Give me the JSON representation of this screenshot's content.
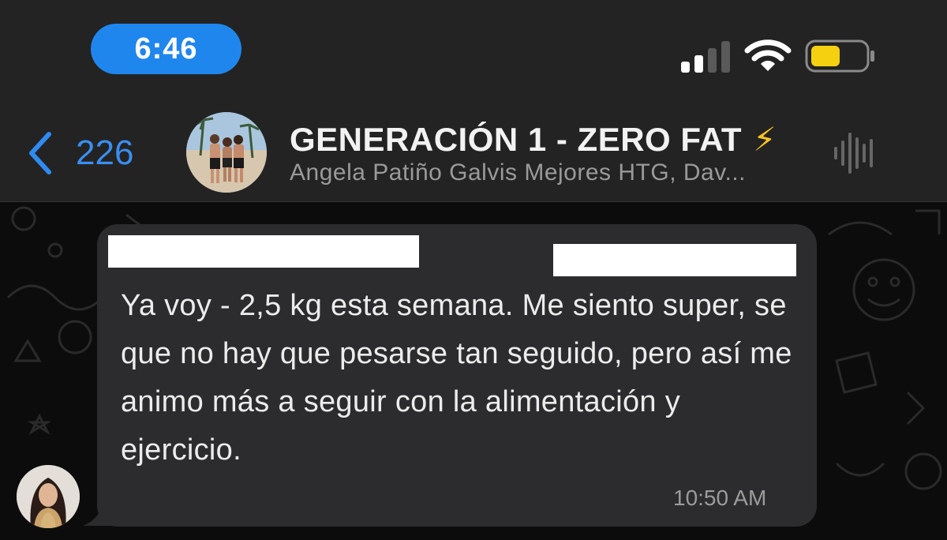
{
  "status_bar": {
    "time": "6:46",
    "signal_icon": "cellular-signal-icon",
    "wifi_icon": "wifi-icon",
    "battery_icon": "battery-low-icon",
    "battery_color": "#f5d010"
  },
  "header": {
    "back_count": "226",
    "group_name": "GENERACIÓN 1 - ZERO FAT",
    "group_emoji": "⚡",
    "members": "Angela Patiño Galvis Mejores HTG, Dav...",
    "audio_icon": "voice-waveform-icon"
  },
  "message": {
    "text": "Ya voy - 2,5 kg esta semana. Me siento super, se que no hay que pesarse tan seguido, pero así me animo más a seguir con la alimentación y ejercicio.",
    "time": "10:50 AM"
  },
  "colors": {
    "accent": "#1f86ee",
    "header_bg": "#232323",
    "bubble_bg": "#2c2c2e",
    "chat_bg": "#0c0c0c"
  }
}
